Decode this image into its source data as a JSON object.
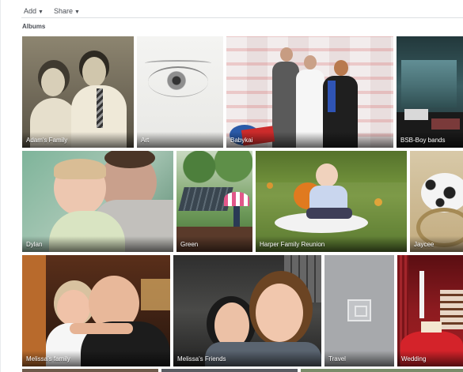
{
  "toolbar": {
    "add_label": "Add",
    "share_label": "Share"
  },
  "section": {
    "title": "Albums"
  },
  "albums": [
    {
      "label": "Adam's Family"
    },
    {
      "label": "Art"
    },
    {
      "label": "Babykai"
    },
    {
      "label": "BSB-Boy bands"
    },
    {
      "label": "Dylan"
    },
    {
      "label": "Green"
    },
    {
      "label": "Harper Family Reunion"
    },
    {
      "label": "Jaycee"
    },
    {
      "label": "Melissa's family"
    },
    {
      "label": "Melissa's Friends"
    },
    {
      "label": "Travel"
    },
    {
      "label": "Wedding"
    }
  ],
  "icons": {
    "caret": "chevron-down-icon",
    "placeholder": "photo-placeholder-icon"
  }
}
